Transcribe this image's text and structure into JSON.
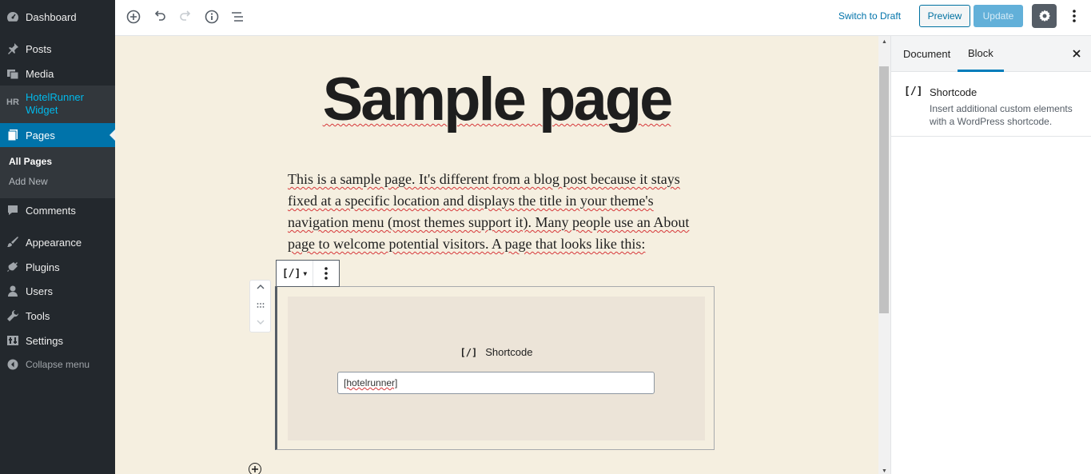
{
  "admin_menu": {
    "items": [
      {
        "label": "Dashboard",
        "icon": "dashboard-icon"
      },
      {
        "label": "Posts",
        "icon": "pin-icon"
      },
      {
        "label": "Media",
        "icon": "media-icon"
      },
      {
        "label": "HotelRunner Widget",
        "icon": "hr-logo-icon"
      },
      {
        "label": "Pages",
        "icon": "pages-icon"
      },
      {
        "label": "Comments",
        "icon": "comment-icon"
      },
      {
        "label": "Appearance",
        "icon": "brush-icon"
      },
      {
        "label": "Plugins",
        "icon": "plug-icon"
      },
      {
        "label": "Users",
        "icon": "user-icon"
      },
      {
        "label": "Tools",
        "icon": "wrench-icon"
      },
      {
        "label": "Settings",
        "icon": "settings-icon"
      }
    ],
    "submenu": [
      "All Pages",
      "Add New"
    ],
    "collapse_label": "Collapse menu"
  },
  "header": {
    "switch_to_draft": "Switch to Draft",
    "preview": "Preview",
    "update": "Update"
  },
  "editor": {
    "title": "Sample page",
    "paragraph": "This is a sample page. It's different from a blog post because it stays fixed at a specific location and displays the title in your theme's navigation menu (most themes support it). Many people use an About page to welcome potential visitors. A page that looks like this:",
    "block_icon": "[/]",
    "shortcode_label": "Shortcode",
    "shortcode_value": "[hotelrunner]"
  },
  "sidebar": {
    "tabs": [
      "Document",
      "Block"
    ],
    "active_tab": "Block",
    "block_icon": "[/]",
    "block_title": "Shortcode",
    "block_description": "Insert additional custom elements with a WordPress shortcode."
  },
  "colors": {
    "admin_bg": "#23282d",
    "admin_active": "#0073aa",
    "editor_bg": "#f5efe0",
    "accent": "#007cba"
  }
}
